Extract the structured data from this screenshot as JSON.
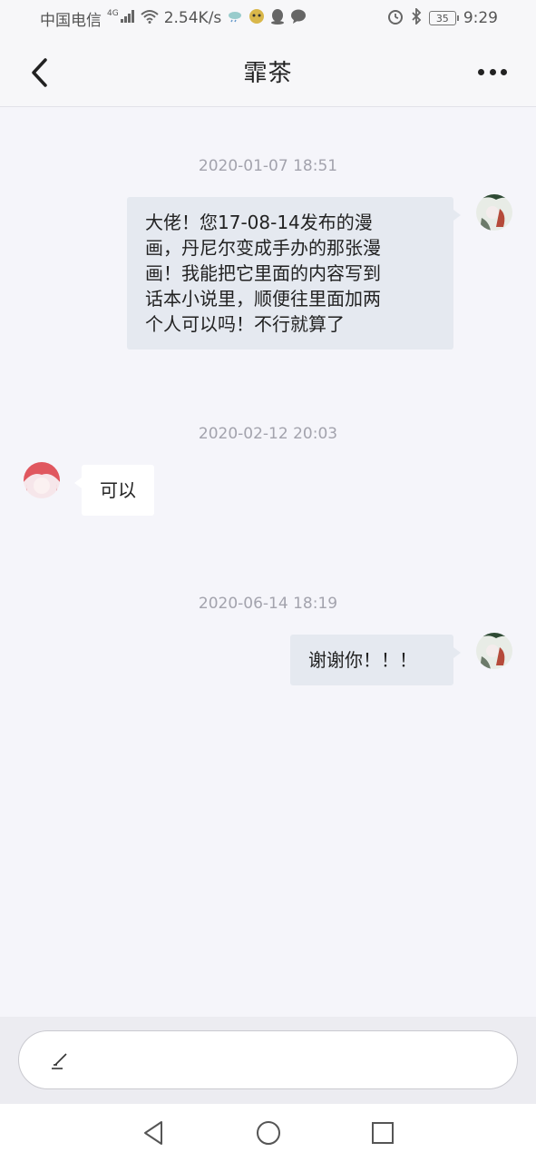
{
  "status_bar": {
    "carrier": "中国电信",
    "network_type": "4G",
    "speed": "2.54K/s",
    "battery": "35",
    "time": "9:29",
    "icons": [
      "signal-icon",
      "wifi-icon",
      "weather-icon",
      "app-icon",
      "qq-icon",
      "message-icon",
      "alarm-icon",
      "bluetooth-icon",
      "battery-icon"
    ]
  },
  "header": {
    "title": "霏茶",
    "back_icon": "chevron-left-icon",
    "more_icon": "more-dots-icon"
  },
  "messages": [
    {
      "timestamp": "2020-01-07 18:51",
      "direction": "outgoing",
      "lines": [
        "大佬！您17-08-14发布的漫",
        "画，丹尼尔变成手办的那张漫",
        "画！我能把它里面的内容写到",
        "话本小说里，顺便往里面加两",
        "个人可以吗！不行就算了"
      ]
    },
    {
      "timestamp": "2020-02-12 20:03",
      "direction": "incoming",
      "lines": [
        "可以"
      ]
    },
    {
      "timestamp": "2020-06-14 18:19",
      "direction": "outgoing",
      "lines": [
        "谢谢你！！！"
      ]
    }
  ],
  "input": {
    "placeholder": "",
    "icon": "pen-icon"
  },
  "system_nav": {
    "back_icon": "triangle-back-icon",
    "home_icon": "circle-home-icon",
    "recent_icon": "square-recent-icon"
  },
  "colors": {
    "background": "#f5f5fa",
    "outgoing_bubble": "#e5e9f0",
    "incoming_bubble": "#ffffff",
    "timestamp": "#a3a3ad"
  }
}
